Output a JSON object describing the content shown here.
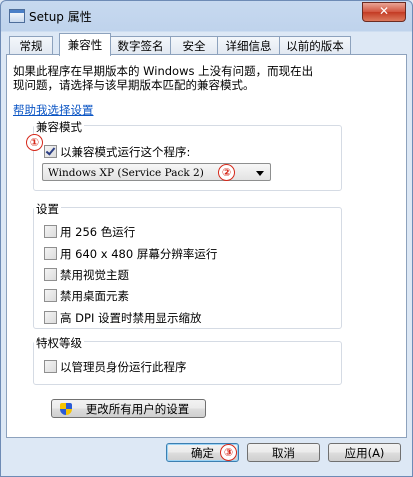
{
  "window": {
    "title": "Setup 属性",
    "close_glyph": "✕"
  },
  "tabs": [
    {
      "label": "常规"
    },
    {
      "label": "兼容性"
    },
    {
      "label": "数字签名"
    },
    {
      "label": "安全"
    },
    {
      "label": "详细信息"
    },
    {
      "label": "以前的版本"
    }
  ],
  "intro": {
    "text": "如果此程序在早期版本的 Windows 上没有问题，而现在出\n现问题，请选择与该早期版本匹配的兼容模式。"
  },
  "help_link": "帮助我选择设置",
  "compat_mode": {
    "title": "兼容模式",
    "checkbox_label": "以兼容模式运行这个程序:",
    "checked": true,
    "selected_os": "Windows XP (Service Pack 2)"
  },
  "settings": {
    "title": "设置",
    "items": [
      {
        "label": "用 256 色运行",
        "checked": false
      },
      {
        "label": "用 640 x 480 屏幕分辨率运行",
        "checked": false
      },
      {
        "label": "禁用视觉主题",
        "checked": false
      },
      {
        "label": "禁用桌面元素",
        "checked": false
      },
      {
        "label": "高 DPI 设置时禁用显示缩放",
        "checked": false
      }
    ]
  },
  "privilege": {
    "title": "特权等级",
    "checkbox_label": "以管理员身份运行此程序",
    "checked": false
  },
  "all_users_button": "更改所有用户的设置",
  "buttons": {
    "ok": "确定",
    "cancel": "取消",
    "apply": "应用(A)"
  },
  "annotations": [
    "①",
    "②",
    "③"
  ],
  "colors": {
    "annotation": "#d6291b",
    "link": "#0b55c4"
  }
}
